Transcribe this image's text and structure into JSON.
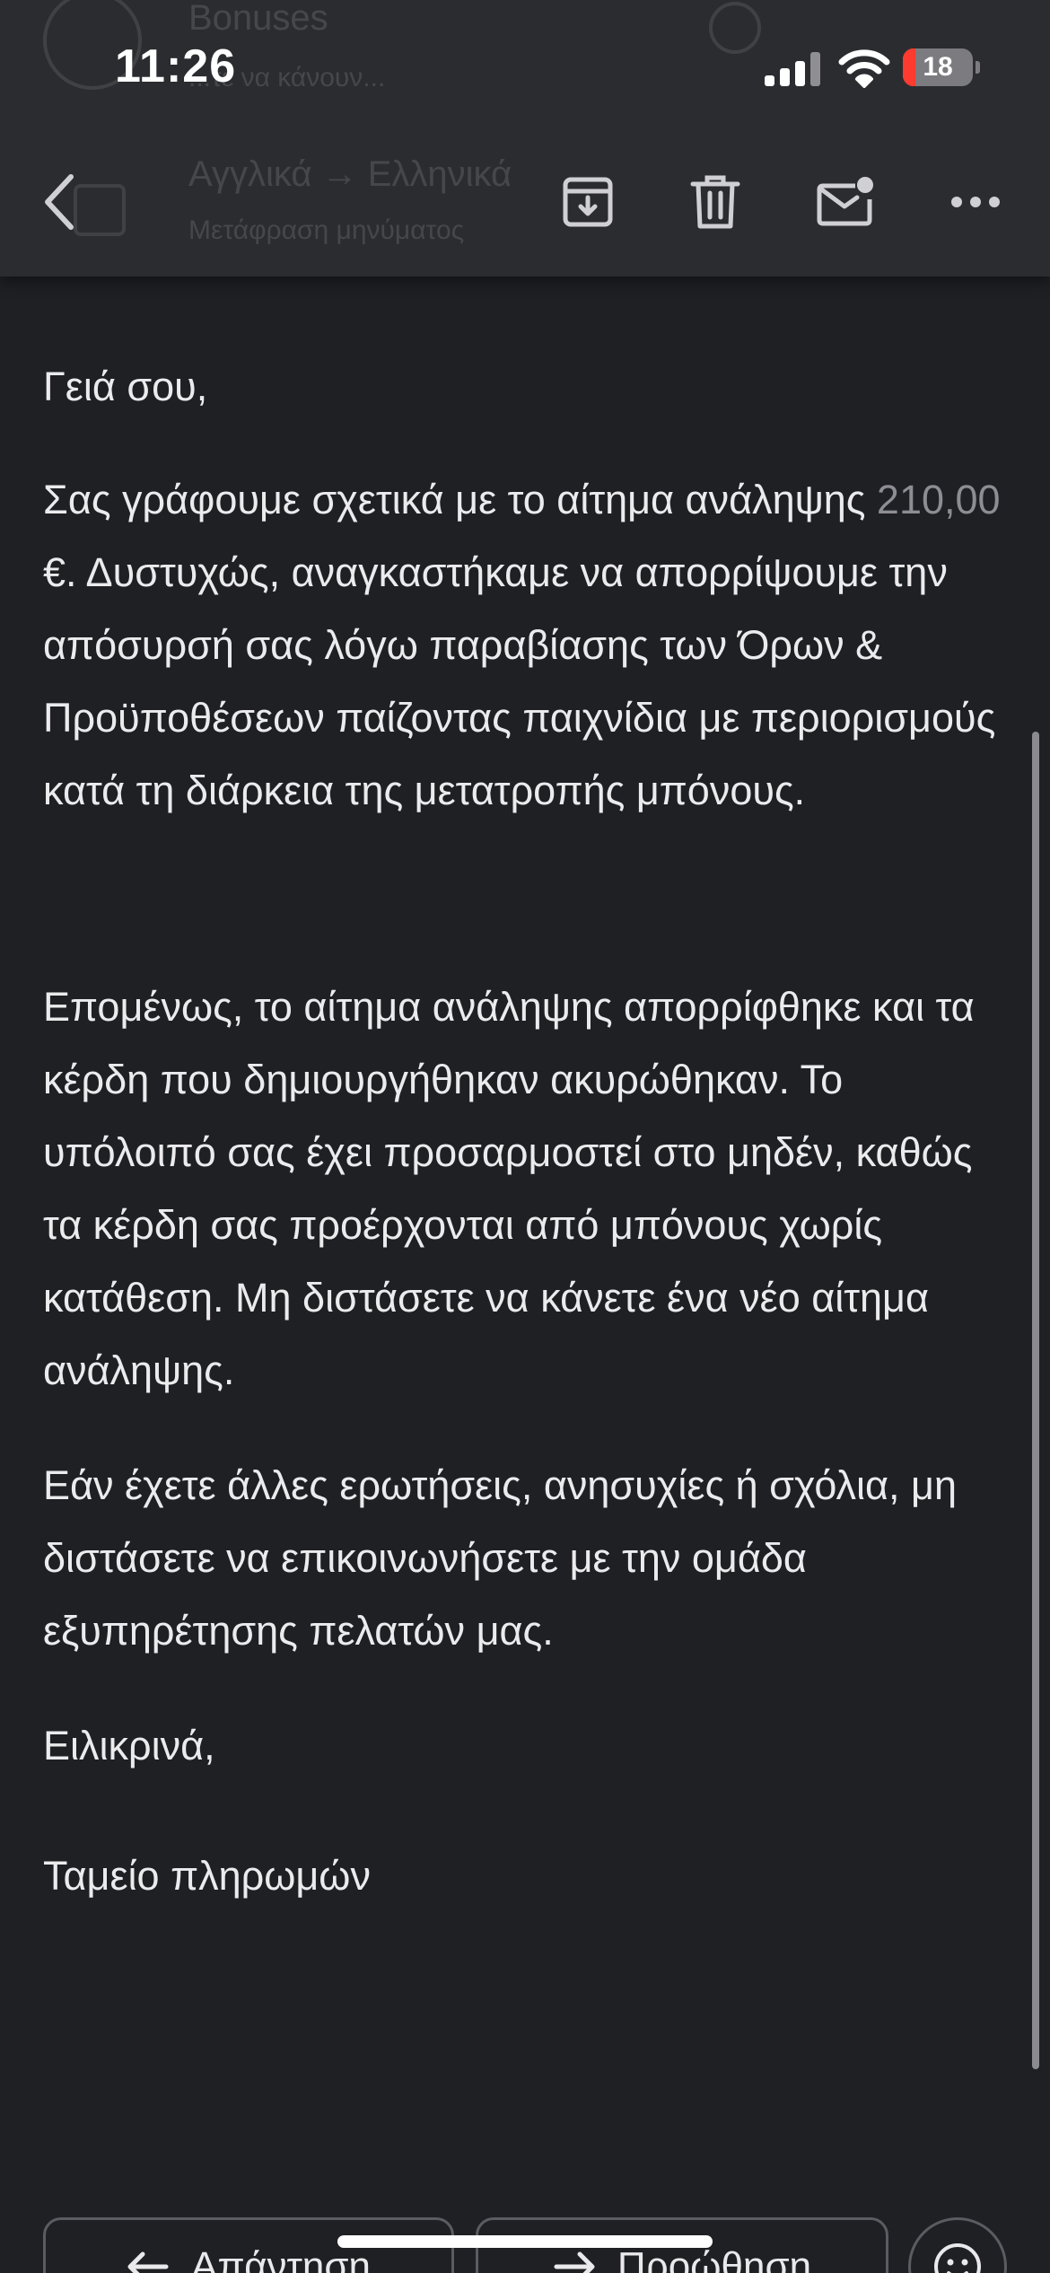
{
  "status_bar": {
    "time": "11:26",
    "battery_level": "18",
    "battery_color": "#ff3b30"
  },
  "background_list": {
    "items": [
      {
        "title": "Bonuses",
        "subtitle": "...τε να κάνουν..."
      },
      {
        "title": "Αγγλικά → Ελληνικά",
        "subtitle": "Μετάφραση μηνύματος"
      }
    ]
  },
  "toolbar": {
    "back_icon": "chevron-left-icon",
    "archive_icon": "archive-icon",
    "delete_icon": "trash-icon",
    "mark_unread_icon": "mail-unread-icon",
    "more_icon": "more-icon"
  },
  "email": {
    "greeting": "Γειά σου,",
    "para1_before": "Σας γράφουμε σχετικά με το αίτημα ανάληψης ",
    "para1_amount": "210,00",
    "para1_after": " €. Δυστυχώς, αναγκαστήκαμε να απορρίψουμε την απόσυρσή σας λόγω παραβίασης των Όρων & Προϋποθέσεων παίζοντας παιχνίδια με περιορισμούς κατά τη διάρκεια της μετατροπής μπόνους.",
    "para2": "Επομένως, το αίτημα ανάληψης απορρίφθηκε και τα κέρδη που δημιουργήθηκαν ακυρώθηκαν. Το υπόλοιπό σας έχει προσαρμοστεί στο μηδέν, καθώς τα κέρδη σας προέρχονται από μπόνους χωρίς κατάθεση. Μη διστάσετε να κάνετε ένα νέο αίτημα ανάληψης.",
    "para3": "Εάν έχετε άλλες ερωτήσεις, ανησυχίες ή σχόλια, μη διστάσετε να επικοινωνήσετε με την ομάδα εξυπηρέτησης πελατών μας.",
    "closing": "Ειλικρινά,",
    "signature": "Ταμείο πληρωμών"
  },
  "actions": {
    "reply_label": "Απάντηση",
    "forward_label": "Προώθηση",
    "reaction_icon": "emoji-icon"
  }
}
